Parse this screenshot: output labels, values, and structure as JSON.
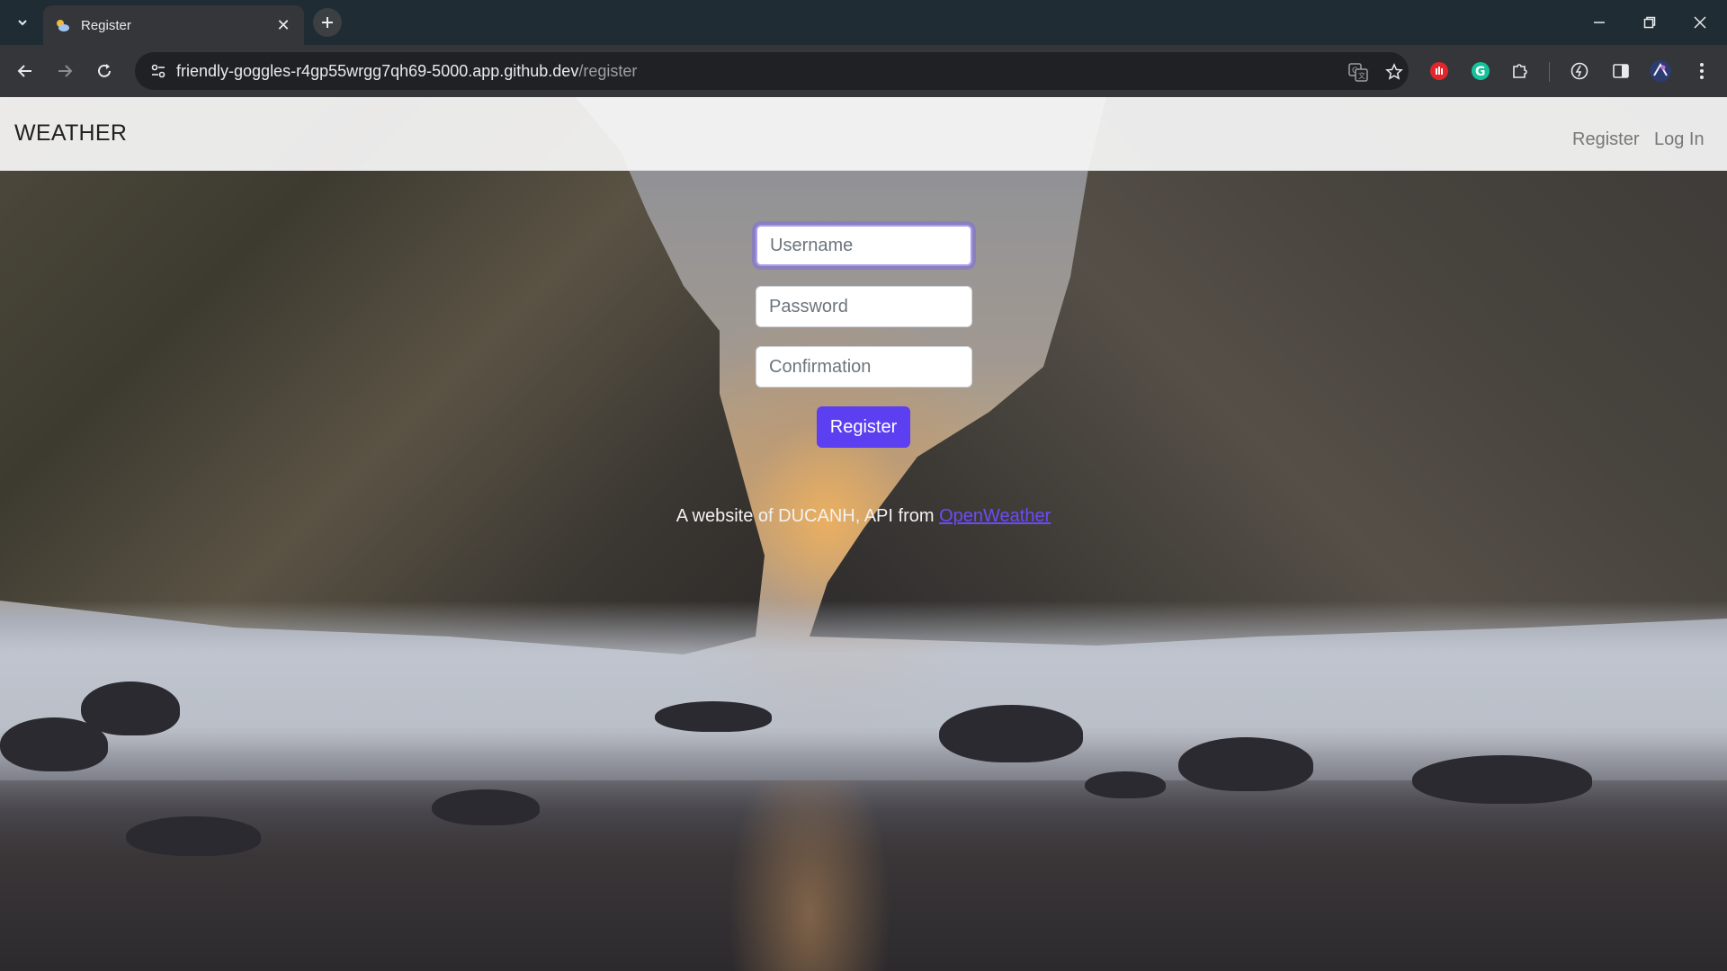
{
  "browser": {
    "tab_title": "Register",
    "url_host": "friendly-goggles-r4gp55wrgg7qh69-5000.app.github.dev",
    "url_path": "/register",
    "accent": "#35363a"
  },
  "navbar": {
    "brand": "WEATHER",
    "links": [
      "Register",
      "Log In"
    ]
  },
  "form": {
    "username_placeholder": "Username",
    "password_placeholder": "Password",
    "confirmation_placeholder": "Confirmation",
    "submit_label": "Register",
    "button_color": "#5b3ff1"
  },
  "footer": {
    "text": "A website of DUCANH, API from ",
    "link_text": "OpenWeather"
  }
}
